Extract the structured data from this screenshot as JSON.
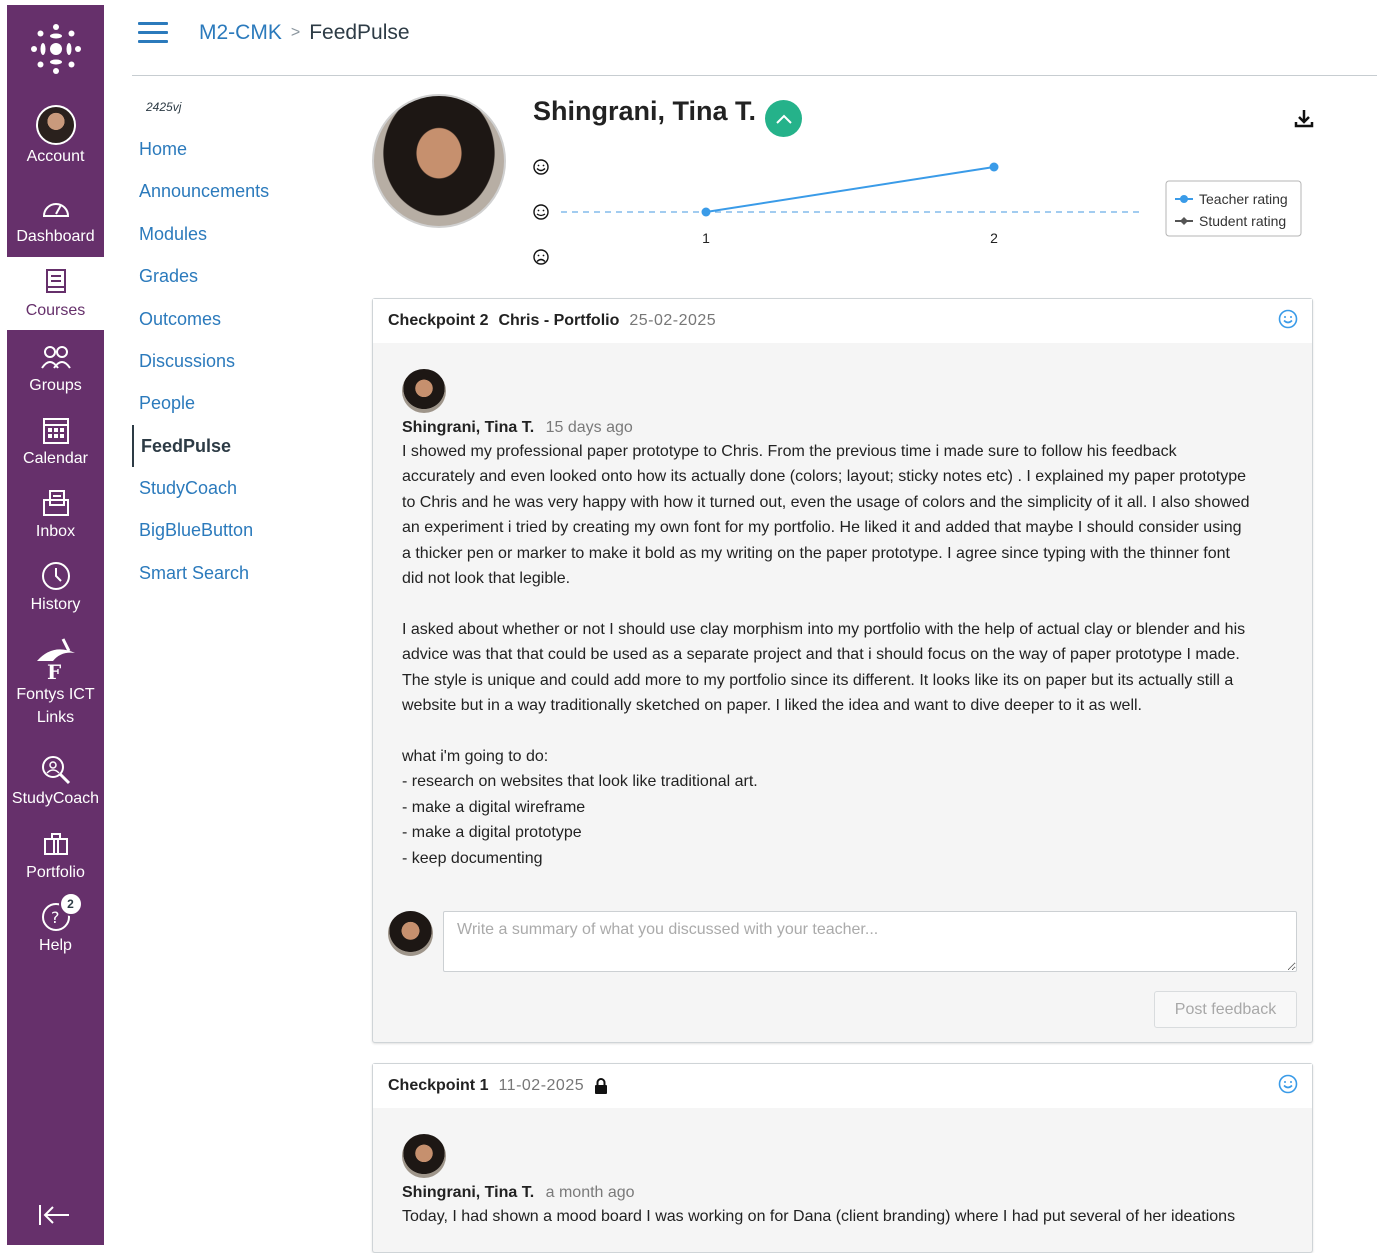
{
  "global_nav": {
    "items": [
      {
        "label": "Account",
        "icon": "avatar"
      },
      {
        "label": "Dashboard",
        "icon": "dashboard-icon"
      },
      {
        "label": "Courses",
        "icon": "courses-icon"
      },
      {
        "label": "Groups",
        "icon": "groups-icon"
      },
      {
        "label": "Calendar",
        "icon": "calendar-icon"
      },
      {
        "label": "Inbox",
        "icon": "inbox-icon"
      },
      {
        "label": "History",
        "icon": "history-icon"
      },
      {
        "label": "Fontys ICT Links",
        "icon": "fontys-icon"
      },
      {
        "label": "StudyCoach",
        "icon": "studycoach-icon"
      },
      {
        "label": "Portfolio",
        "icon": "portfolio-icon"
      },
      {
        "label": "Help",
        "icon": "help-icon",
        "badge": "2"
      }
    ],
    "colors": {
      "background": "#66306b",
      "active_text": "#66306b"
    }
  },
  "header": {
    "crumb_course": "M2-CMK",
    "crumb_current": "FeedPulse"
  },
  "course_nav": {
    "term": "2425vj",
    "items": [
      "Home",
      "Announcements",
      "Modules",
      "Grades",
      "Outcomes",
      "Discussions",
      "People",
      "FeedPulse",
      "StudyCoach",
      "BigBlueButton",
      "Smart Search"
    ],
    "active": "FeedPulse"
  },
  "student": {
    "name": "Shingrani, Tina T."
  },
  "chart_data": {
    "type": "line",
    "x": [
      1,
      2
    ],
    "x_ticks": [
      "1",
      "2"
    ],
    "y_levels": [
      "happy",
      "neutral",
      "sad"
    ],
    "series": [
      {
        "name": "Teacher rating",
        "values": [
          "neutral",
          "happy"
        ],
        "color": "#3a9be8"
      },
      {
        "name": "Student rating",
        "values": [],
        "color": "#555555"
      }
    ],
    "legend": "right"
  },
  "checkpoints": [
    {
      "label": "Checkpoint 2",
      "context": "Chris - Portfolio",
      "date": "25-02-2025",
      "locked": false,
      "post": {
        "author": "Shingrani, Tina T.",
        "time": "15 days ago",
        "lines": [
          "I showed my professional paper prototype to Chris. From the previous time i made sure to follow his feedback",
          "accurately and even looked onto how its actually done (colors; layout; sticky notes etc) . I explained my paper prototype",
          "to Chris and he was very happy with how it turned out, even the usage of colors and the simplicity of it all. I also showed",
          "an experiment i tried by creating my own font for my portfolio. He liked it and added that maybe I should consider using",
          "a thicker pen or marker to make it bold as my writing on the paper prototype. I agree since typing with the thinner font",
          "did not look that legible.",
          "",
          "I asked about whether or not I should use clay morphism into my portfolio with the help of actual clay or blender and his",
          "advice was that that could be used as a separate project and that i should focus on the way of paper prototype I made.",
          "The style is unique and could add more to my portfolio since its different. It looks like its on paper but its actually still a",
          "website but in a way traditionally sketched on paper. I liked the idea and want to dive deeper to it as well.",
          "",
          "what i'm going to do:",
          "- research on websites that look like traditional art.",
          "- make a digital wireframe",
          "- make a digital prototype",
          "- keep documenting"
        ]
      },
      "reply_placeholder": "Write a summary of what you discussed with your teacher...",
      "post_button": "Post feedback"
    },
    {
      "label": "Checkpoint 1",
      "date": "11-02-2025",
      "locked": true,
      "post": {
        "author": "Shingrani, Tina T.",
        "time": "a month ago",
        "lines": [
          "Today, I had shown a mood board I was working on for Dana (client branding) where I had put several of her ideations"
        ]
      }
    }
  ],
  "accent_colors": {
    "link": "#2b7abc",
    "success": "#25b28a",
    "face_icon": "#3a9be8"
  }
}
